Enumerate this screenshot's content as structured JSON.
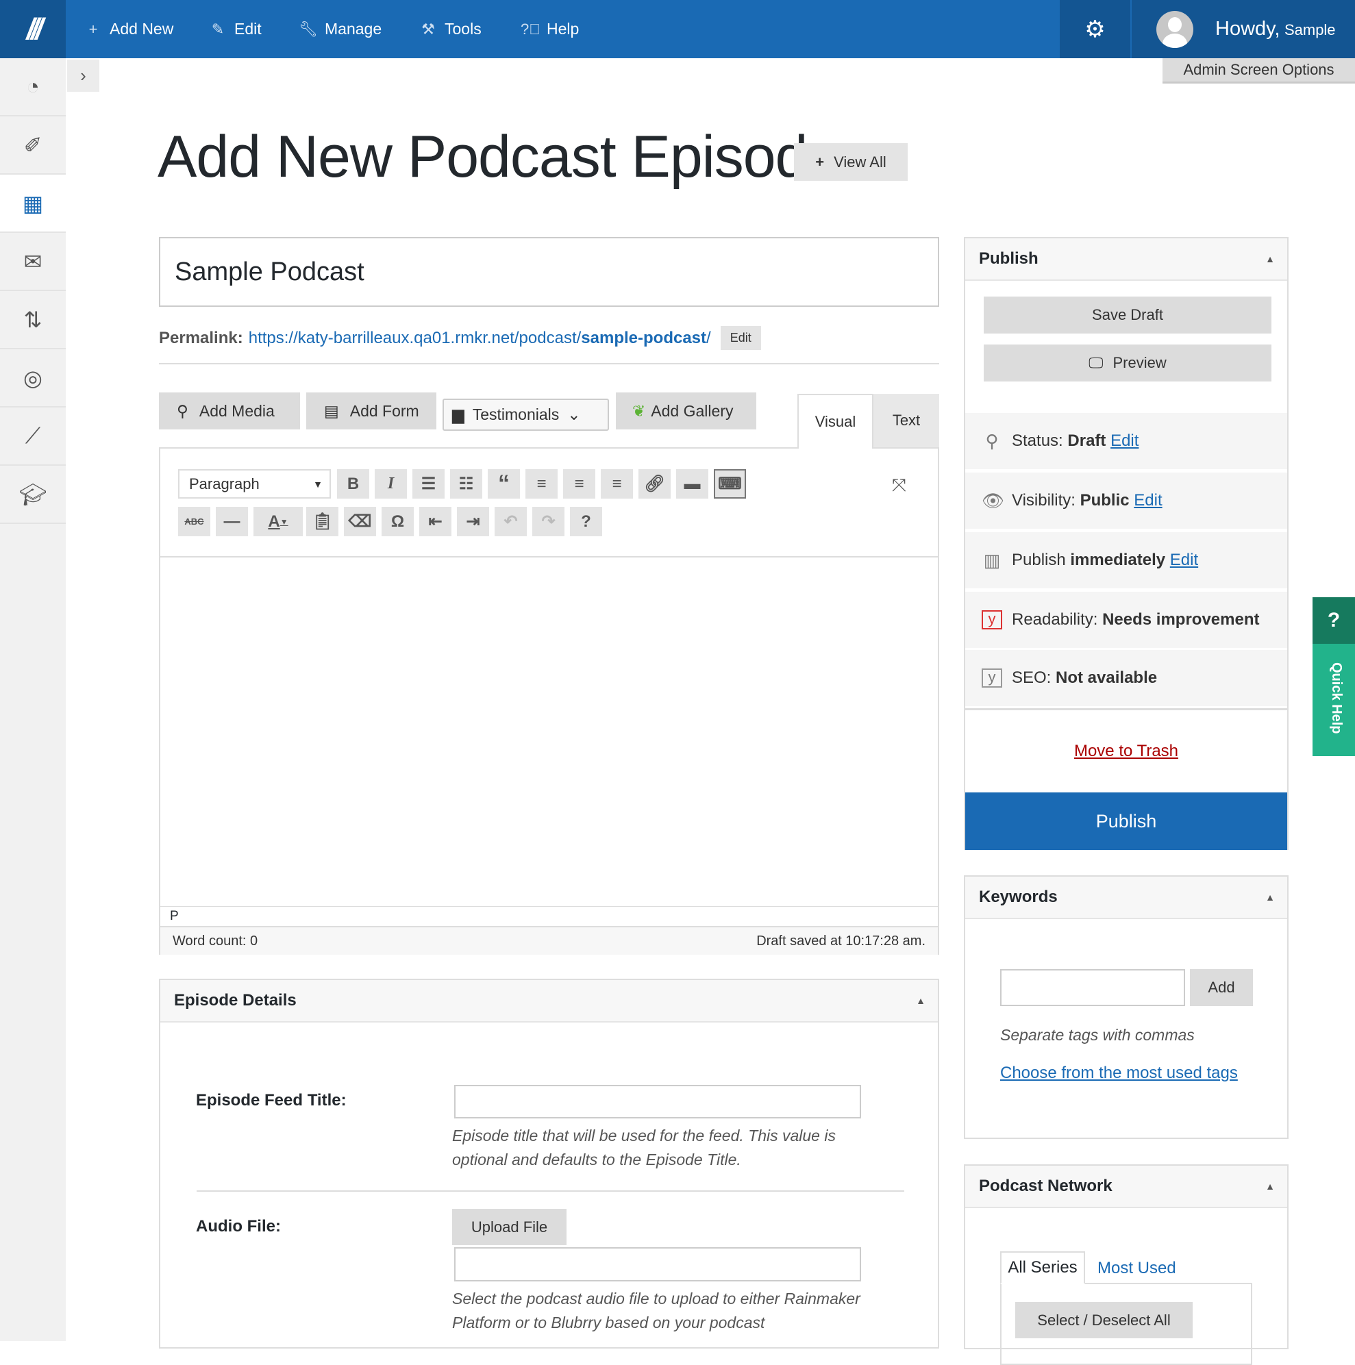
{
  "topbar": {
    "nav": [
      {
        "icon": "plus-icon",
        "label": "Add New"
      },
      {
        "icon": "pencil-icon",
        "label": "Edit"
      },
      {
        "icon": "wrench-icon",
        "label": "Manage"
      },
      {
        "icon": "hammer-icon",
        "label": "Tools"
      },
      {
        "icon": "help-circle-icon",
        "label": "Help"
      }
    ],
    "howdy": "Howdy,",
    "user": "Sample",
    "screen_options": "Admin Screen Options"
  },
  "sidebar": {
    "items": [
      {
        "icon": "dashboard-icon"
      },
      {
        "icon": "pin-icon"
      },
      {
        "icon": "content-icon",
        "active": true
      },
      {
        "icon": "mail-icon"
      },
      {
        "icon": "transfer-icon"
      },
      {
        "icon": "target-icon"
      },
      {
        "icon": "analytics-icon"
      },
      {
        "icon": "graduation-cap-icon"
      }
    ]
  },
  "page": {
    "title": "Add New Podcast Episode",
    "view_all": "View All"
  },
  "post": {
    "title_value": "Sample Podcast",
    "permalink_label": "Permalink:",
    "permalink_base": "https://katy-barrilleaux.qa01.rmkr.net/podcast/",
    "permalink_slug": "sample-podcast",
    "permalink_trail": "/",
    "permalink_edit": "Edit"
  },
  "media_buttons": {
    "add_media": "Add Media",
    "add_form": "Add Form",
    "testimonials": "Testimonials",
    "add_gallery": "Add Gallery"
  },
  "editor": {
    "tabs": {
      "visual": "Visual",
      "text": "Text"
    },
    "format": "Paragraph",
    "path": "P",
    "word_count": "Word count: 0",
    "draft_saved": "Draft saved at 10:17:28 am."
  },
  "episode": {
    "heading": "Episode Details",
    "feed_title_label": "Episode Feed Title:",
    "feed_title_value": "",
    "feed_title_help": "Episode title that will be used for the feed. This value is optional and defaults to the Episode Title.",
    "audio_label": "Audio File:",
    "upload": "Upload File",
    "audio_value": "",
    "audio_help": "Select the podcast audio file to upload to either Rainmaker Platform or to Blubrry based on your podcast"
  },
  "publish": {
    "heading": "Publish",
    "save_draft": "Save Draft",
    "preview": "Preview",
    "status_label": "Status:",
    "status": "Draft",
    "visibility_label": "Visibility:",
    "visibility": "Public",
    "publish_label": "Publish",
    "publish_when": "immediately",
    "edit": "Edit",
    "readability_label": "Readability:",
    "readability": "Needs improvement",
    "seo_label": "SEO:",
    "seo": "Not available",
    "trash": "Move to Trash",
    "publish_button": "Publish"
  },
  "keywords": {
    "heading": "Keywords",
    "value": "",
    "add": "Add",
    "hint": "Separate tags with commas",
    "choose": "Choose from the most used tags"
  },
  "network": {
    "heading": "Podcast Network",
    "tab_all": "All Series",
    "tab_most": "Most Used",
    "select_all": "Select / Deselect All"
  },
  "quick_help": {
    "q": "?",
    "label": "Quick Help"
  },
  "colors": {
    "accent": "#1a6ab4",
    "topbar_dark": "#135592",
    "trash": "#aa0000",
    "quick_help": "#22b38b"
  }
}
